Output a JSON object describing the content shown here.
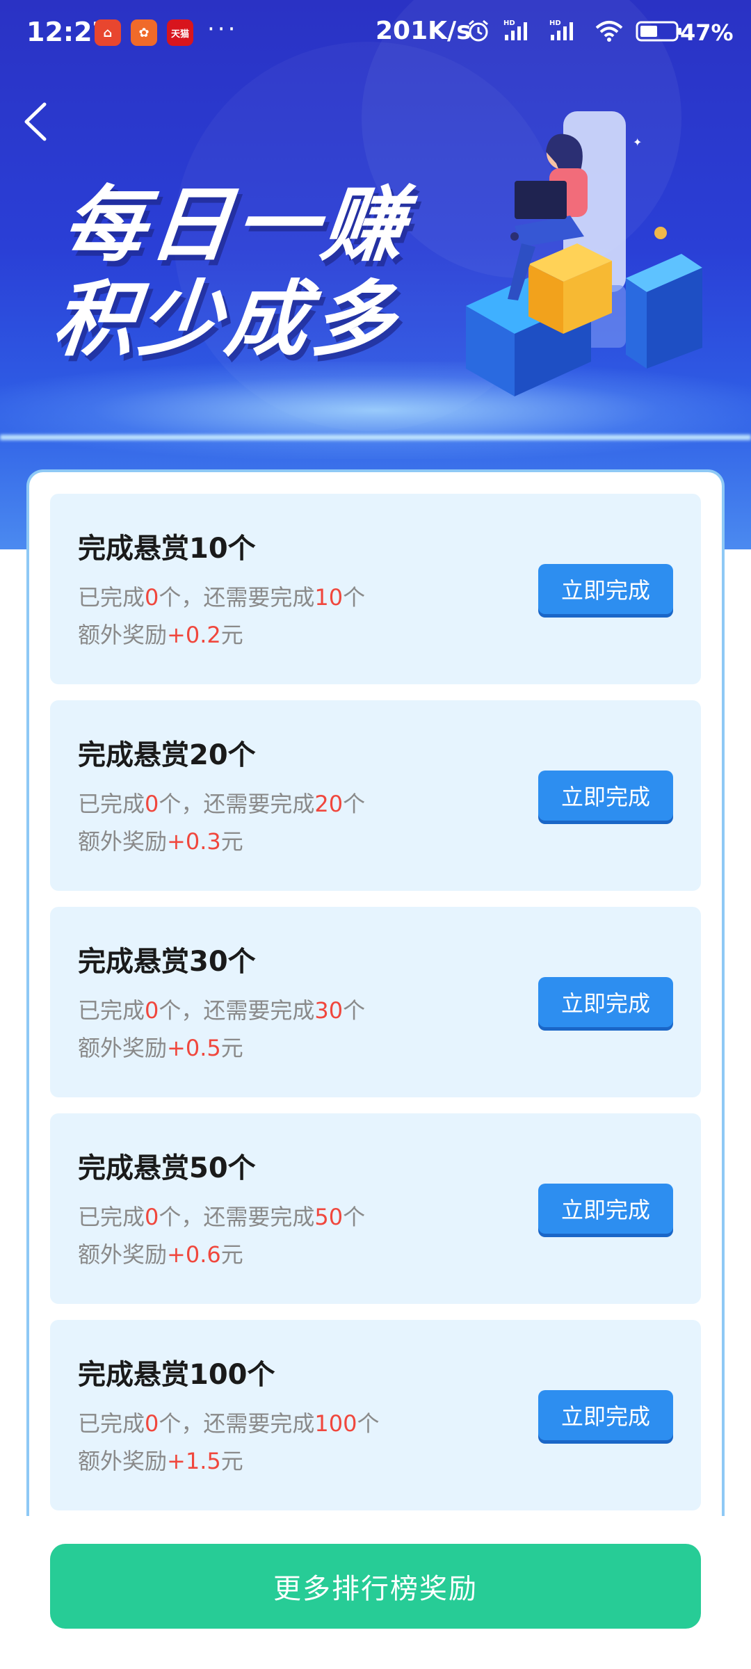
{
  "status_bar": {
    "time": "12:27",
    "dots": "···",
    "speed": "201K/s",
    "battery": "47%",
    "app_badges": [
      "⌂",
      "✿",
      "天猫"
    ]
  },
  "banner": {
    "title_line1": "每日一赚",
    "title_line2": "积少成多"
  },
  "tasks": [
    {
      "title": "完成悬赏10个",
      "done_prefix": "已完成",
      "done_count": "0",
      "remain_mid": "个，还需要完成",
      "remain_count": "10",
      "remain_suffix": "个",
      "bonus_prefix": "额外奖励",
      "bonus_value": "+0.2",
      "bonus_unit": "元",
      "button": "立即完成"
    },
    {
      "title": "完成悬赏20个",
      "done_prefix": "已完成",
      "done_count": "0",
      "remain_mid": "个，还需要完成",
      "remain_count": "20",
      "remain_suffix": "个",
      "bonus_prefix": "额外奖励",
      "bonus_value": "+0.3",
      "bonus_unit": "元",
      "button": "立即完成"
    },
    {
      "title": "完成悬赏30个",
      "done_prefix": "已完成",
      "done_count": "0",
      "remain_mid": "个，还需要完成",
      "remain_count": "30",
      "remain_suffix": "个",
      "bonus_prefix": "额外奖励",
      "bonus_value": "+0.5",
      "bonus_unit": "元",
      "button": "立即完成"
    },
    {
      "title": "完成悬赏50个",
      "done_prefix": "已完成",
      "done_count": "0",
      "remain_mid": "个，还需要完成",
      "remain_count": "50",
      "remain_suffix": "个",
      "bonus_prefix": "额外奖励",
      "bonus_value": "+0.6",
      "bonus_unit": "元",
      "button": "立即完成"
    },
    {
      "title": "完成悬赏100个",
      "done_prefix": "已完成",
      "done_count": "0",
      "remain_mid": "个，还需要完成",
      "remain_count": "100",
      "remain_suffix": "个",
      "bonus_prefix": "额外奖励",
      "bonus_value": "+1.5",
      "bonus_unit": "元",
      "button": "立即完成"
    }
  ],
  "footer": {
    "more_button": "更多排行榜奖励"
  },
  "colors": {
    "accent_blue": "#2d8ef0",
    "highlight_red": "#f0473d",
    "footer_green": "#27cc96",
    "task_bg": "#e6f4fe"
  }
}
